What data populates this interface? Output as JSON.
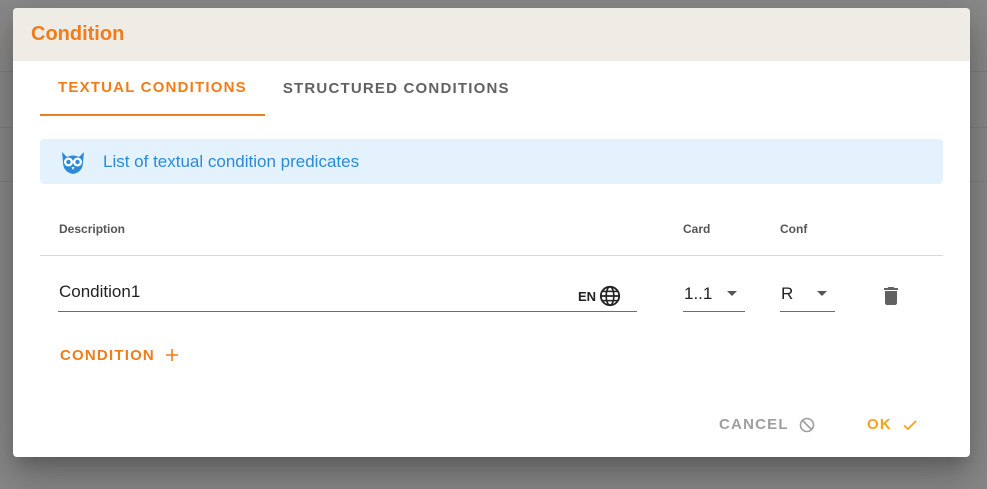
{
  "dialog": {
    "title": "Condition"
  },
  "tabs": [
    {
      "label": "TEXTUAL CONDITIONS",
      "active": true
    },
    {
      "label": "STRUCTURED CONDITIONS",
      "active": false
    }
  ],
  "info": {
    "icon": "owl-icon",
    "text": "List of textual condition predicates"
  },
  "table": {
    "headers": {
      "description": "Description",
      "card": "Card",
      "conf": "Conf"
    },
    "rows": [
      {
        "description": "Condition1",
        "language": "EN",
        "card": "1..1",
        "conf": "R"
      }
    ]
  },
  "add_button": {
    "label": "CONDITION"
  },
  "actions": {
    "cancel": "CANCEL",
    "ok": "OK"
  },
  "colors": {
    "accent": "#f07d1a",
    "info_text": "#2b8ad8",
    "info_bg": "#e3f2fd",
    "header_bg": "#efebe5",
    "ok": "#f7a21b"
  }
}
